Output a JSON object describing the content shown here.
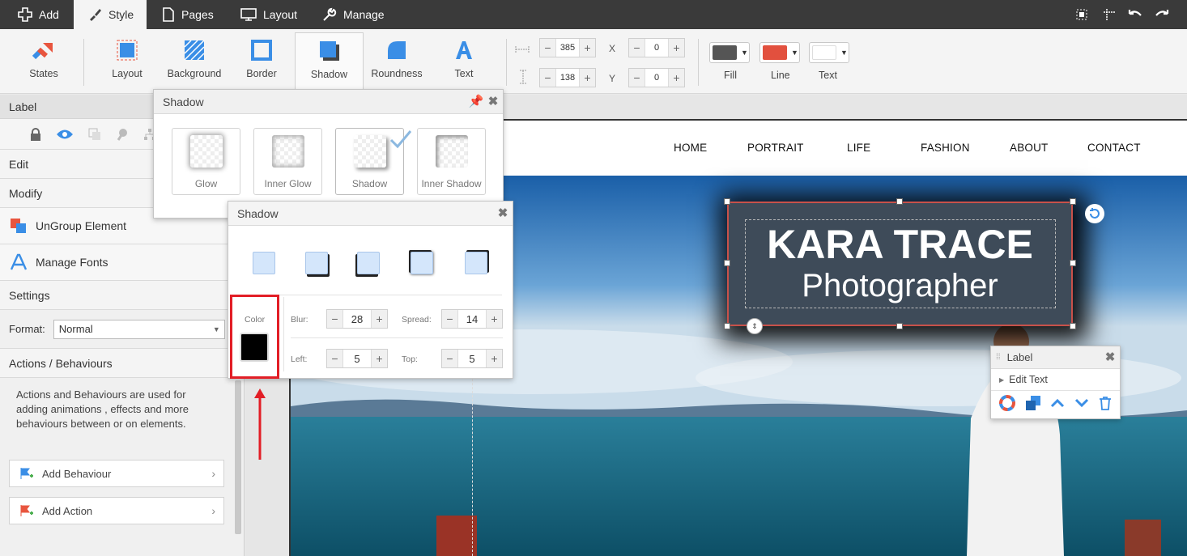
{
  "topbar": {
    "menu": [
      {
        "label": "Add",
        "icon": "plus-icon"
      },
      {
        "label": "Style",
        "icon": "brush-icon"
      },
      {
        "label": "Pages",
        "icon": "page-icon"
      },
      {
        "label": "Layout",
        "icon": "monitor-icon"
      },
      {
        "label": "Manage",
        "icon": "wrench-icon"
      }
    ],
    "active": "Style",
    "right_icons": [
      "select-area-icon",
      "crosshair-icon",
      "undo-icon",
      "redo-icon"
    ]
  },
  "toolbar": {
    "tools": [
      {
        "label": "States",
        "icon": "states-icon"
      },
      {
        "label": "Layout",
        "icon": "layout-icon"
      },
      {
        "label": "Background",
        "icon": "background-icon"
      },
      {
        "label": "Border",
        "icon": "border-icon"
      },
      {
        "label": "Shadow",
        "icon": "shadow-icon"
      },
      {
        "label": "Roundness",
        "icon": "roundness-icon"
      },
      {
        "label": "Text",
        "icon": "text-icon"
      }
    ],
    "active_tool": "Shadow",
    "width": "385",
    "height": "138",
    "x_label": "X",
    "x": "0",
    "y_label": "Y",
    "y": "0",
    "swatches": [
      {
        "label": "Fill",
        "color": "#555555"
      },
      {
        "label": "Line",
        "color": "#e2503e"
      },
      {
        "label": "Text",
        "color": "#ffffff"
      }
    ]
  },
  "sidebar": {
    "title": "Label",
    "edit": "Edit",
    "modify": "Modify",
    "ungroup": "UnGroup Element",
    "manage_fonts": "Manage Fonts",
    "settings": "Settings",
    "format_label": "Format:",
    "format_value": "Normal",
    "actions_title": "Actions / Behaviours",
    "actions_desc": "Actions and Behaviours are used for adding animations , effects and more behaviours between or on elements.",
    "add_behaviour": "Add Behaviour",
    "add_action": "Add Action"
  },
  "site": {
    "nav": [
      "HOME",
      "PORTRAIT",
      "LIFE",
      "FASHION",
      "ABOUT",
      "CONTACT"
    ],
    "title": "KARA TRACE",
    "subtitle": "Photographer"
  },
  "shadow_panel": {
    "title": "Shadow",
    "effects": [
      "Glow",
      "Inner Glow",
      "Shadow",
      "Inner Shadow"
    ],
    "selected": "Shadow"
  },
  "shadow_settings": {
    "title": "Shadow",
    "color_label": "Color",
    "color": "#000000",
    "blur_label": "Blur:",
    "blur": "28",
    "spread_label": "Spread:",
    "spread": "14",
    "left_label": "Left:",
    "left": "5",
    "top_label": "Top:",
    "top": "5"
  },
  "label_panel": {
    "title": "Label",
    "edit_text": "Edit Text",
    "icons": [
      "lifebuoy-icon",
      "duplicate-icon",
      "bring-forward-icon",
      "send-backward-icon",
      "trash-icon"
    ]
  },
  "annotation": {
    "color": "#e21e26"
  }
}
